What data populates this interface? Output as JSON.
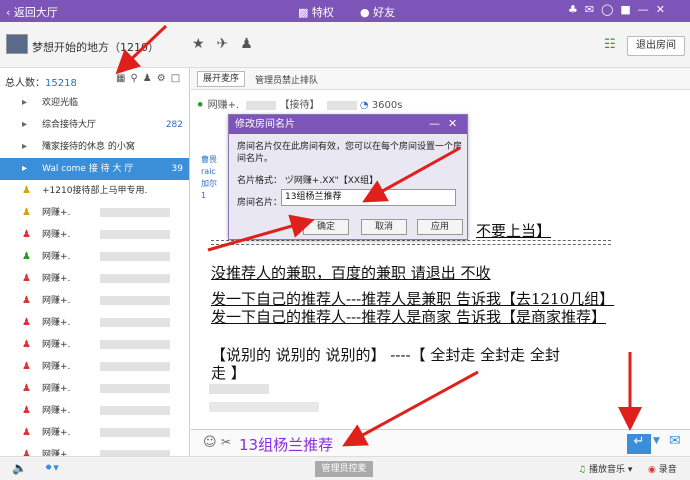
{
  "topbar": {
    "back_label": "返回大厅",
    "privilege_label": "特权",
    "friends_label": "好友"
  },
  "header": {
    "room_name": "梦想开始的地方（1210）",
    "exit_label": "退出房间"
  },
  "left": {
    "total_label": "总人数：",
    "total_count": "15218",
    "rows": [
      {
        "name": "欢迎光临",
        "count": ""
      },
      {
        "name": "综合接待大厅",
        "count": "282"
      },
      {
        "name": "殲家接待的休息 的小窝",
        "count": ""
      },
      {
        "name": "Wal come  接 待 大 厅",
        "count": "39"
      },
      {
        "name": "+1210接待部上马甲专用.",
        "count": ""
      },
      {
        "name": "网赚+.",
        "count": ""
      },
      {
        "name": "网赚+.",
        "count": ""
      },
      {
        "name": "网赚+.",
        "count": ""
      },
      {
        "name": "网赚+.",
        "count": ""
      },
      {
        "name": "网赚+.",
        "count": ""
      },
      {
        "name": "网赚+.",
        "count": ""
      },
      {
        "name": "网赚+.",
        "count": ""
      },
      {
        "name": "网赚+.",
        "count": ""
      },
      {
        "name": "网赚+.",
        "count": ""
      },
      {
        "name": "网赚+.",
        "count": ""
      },
      {
        "name": "网赚+.",
        "count": ""
      },
      {
        "name": "网赚+.",
        "count": ""
      }
    ]
  },
  "right": {
    "expand_label": "展开麦序",
    "admin_label": "管理员禁止排队",
    "mic_user": "网赚+.",
    "mic_tag": "【接待】",
    "mic_time": "3600s",
    "lines": [
      "不要上当】",
      "没推荐人的兼职，百度的兼职  请退出  不收",
      "发一下自己的推荐人---推荐人是兼职  告诉我【去1210几组】",
      "发一下自己的推荐人---推荐人是商家  告诉我【是商家推荐】",
      "【说别的  说别的   说别的】 ----【  全封走   全封走   全封",
      "走  】"
    ],
    "input_text": "13组杨兰推荐"
  },
  "bottom": {
    "admin_mic_label": "管理员控麦",
    "music_label": "播放音乐",
    "record_label": "录音"
  },
  "dialog": {
    "title": "修改房间名片",
    "desc": "房间名片仅在此房间有效，您可以在每个房间设置一个房间名片。",
    "format_label": "名片格式：",
    "format_value": "ヅ网赚+.XX\"【XX组】",
    "name_label": "房间名片：",
    "name_value": "13组杨兰推荐",
    "ok": "确定",
    "cancel": "取消",
    "apply": "应用"
  },
  "colors": {
    "accent": "#7d55b8",
    "selection": "#3b8fd9",
    "annotation_red": "#e0201a"
  }
}
